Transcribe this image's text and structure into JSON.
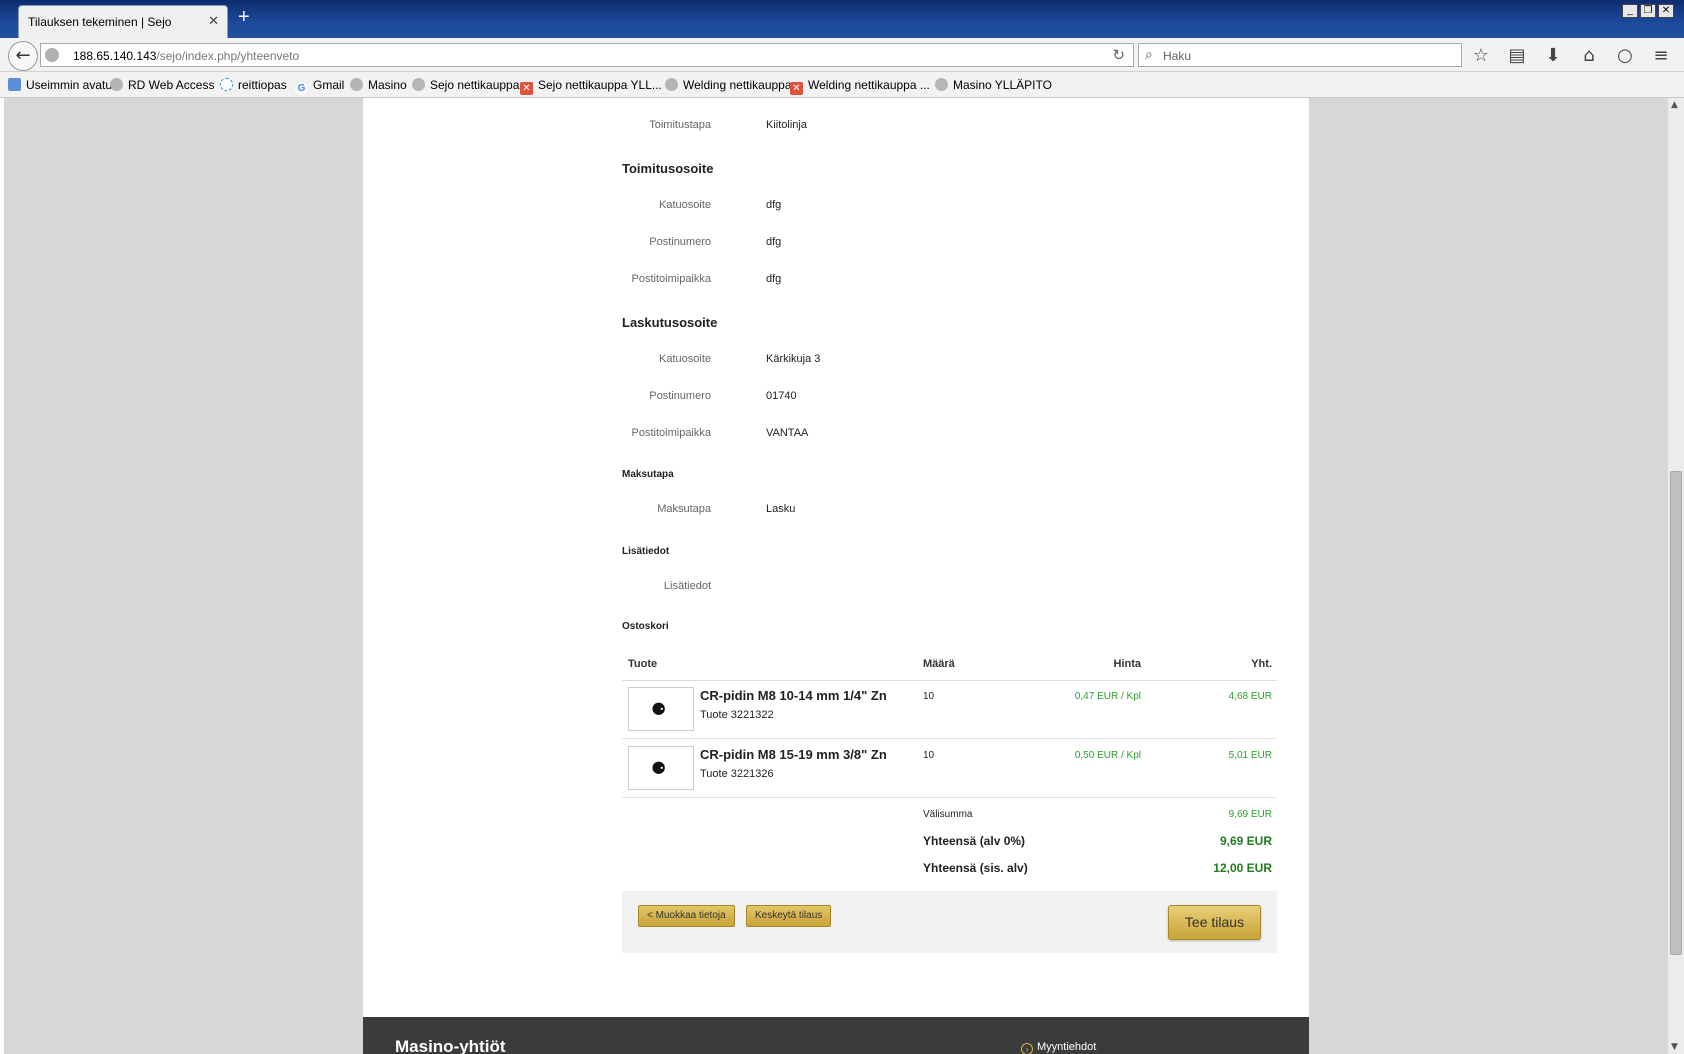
{
  "browser": {
    "tab_title": "Tilauksen tekeminen | Sejo",
    "tab_close": "✕",
    "new_tab": "+",
    "window_controls": [
      "_",
      "❐",
      "✕"
    ],
    "url_host": "188.65.140.143",
    "url_path": "/sejo/index.php/yhteenveto",
    "search_placeholder": "Haku",
    "bookmarks": [
      {
        "label": "Useimmin avatut",
        "icon": "most-visited-icon"
      },
      {
        "label": "RD Web Access",
        "icon": "globe-icon"
      },
      {
        "label": "reittiopas",
        "icon": "sun-icon"
      },
      {
        "label": "Gmail",
        "icon": "google-icon"
      },
      {
        "label": "Masino",
        "icon": "globe-icon"
      },
      {
        "label": "Sejo nettikauppa",
        "icon": "globe-icon"
      },
      {
        "label": "Sejo nettikauppa YLL...",
        "icon": "joomla-icon"
      },
      {
        "label": "Welding nettikauppa",
        "icon": "globe-icon"
      },
      {
        "label": "Welding nettikauppa ...",
        "icon": "joomla-icon"
      },
      {
        "label": "Masino YLLÄPITO",
        "icon": "globe-icon"
      }
    ]
  },
  "order": {
    "delivery": {
      "label": "Toimitustapa",
      "value": "Kiitolinja"
    },
    "shipping_address": {
      "heading": "Toimitusosoite",
      "fields": [
        {
          "label": "Katuosoite",
          "value": "dfg"
        },
        {
          "label": "Postinumero",
          "value": "dfg"
        },
        {
          "label": "Postitoimipaikka",
          "value": "dfg"
        }
      ]
    },
    "billing_address": {
      "heading": "Laskutusosoite",
      "fields": [
        {
          "label": "Katuosoite",
          "value": "Kärkikuja 3"
        },
        {
          "label": "Postinumero",
          "value": "01740"
        },
        {
          "label": "Postitoimipaikka",
          "value": "VANTAA"
        }
      ]
    },
    "payment": {
      "heading": "Maksutapa",
      "label": "Maksutapa",
      "value": "Lasku"
    },
    "additional": {
      "heading": "Lisätiedot",
      "label": "Lisätiedot",
      "value": ""
    },
    "cart": {
      "heading": "Ostoskori",
      "columns": {
        "product": "Tuote",
        "qty": "Määrä",
        "price": "Hinta",
        "total": "Yht."
      },
      "items": [
        {
          "name": "CR-pidin M8 10-14 mm 1/4\" Zn",
          "sku": "Tuote 3221322",
          "qty": "10",
          "price": "0,47 EUR / Kpl",
          "total": "4,68 EUR"
        },
        {
          "name": "CR-pidin M8 15-19 mm 3/8\" Zn",
          "sku": "Tuote 3221326",
          "qty": "10",
          "price": "0,50 EUR / Kpl",
          "total": "5,01 EUR"
        }
      ],
      "subtotal": {
        "label": "Välisumma",
        "value": "9,69 EUR"
      },
      "total_ex_vat": {
        "label": "Yhteensä (alv 0%)",
        "value": "9,69 EUR"
      },
      "total_inc_vat": {
        "label": "Yhteensä (sis. alv)",
        "value": "12,00 EUR"
      }
    },
    "actions": {
      "edit": "< Muokkaa tietoja",
      "cancel": "Keskeytä tilaus",
      "submit": "Tee tilaus"
    }
  },
  "footer": {
    "title": "Masino-yhtiöt",
    "link": "Myyntiehdot"
  },
  "colors": {
    "accent_gold": "#d4b049",
    "price_green": "#2aa12a",
    "total_green": "#1f7d1f",
    "titlebar_blue": "#1d4a9c"
  }
}
